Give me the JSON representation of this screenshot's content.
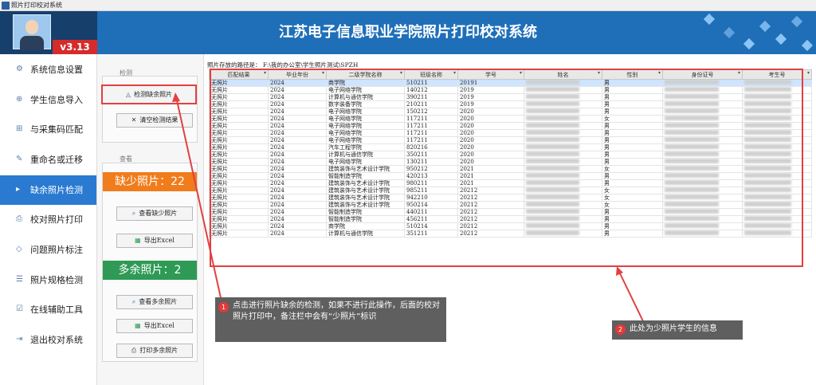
{
  "window": {
    "title": "照片打印校对系统"
  },
  "header": {
    "app_title": "江苏电子信息职业学院照片打印校对系统",
    "version": "v3.13"
  },
  "sidebar": {
    "items": [
      {
        "label": "系统信息设置",
        "icon": "gear-icon"
      },
      {
        "label": "学生信息导入",
        "icon": "import-icon"
      },
      {
        "label": "与采集码匹配",
        "icon": "match-icon"
      },
      {
        "label": "重命名或迁移",
        "icon": "rename-icon"
      },
      {
        "label": "缺余照片检测",
        "icon": "detect-icon",
        "active": true
      },
      {
        "label": "校对照片打印",
        "icon": "print-icon"
      },
      {
        "label": "问题照片标注",
        "icon": "tag-icon"
      },
      {
        "label": "照片规格检测",
        "icon": "spec-icon"
      },
      {
        "label": "在线辅助工具",
        "icon": "tool-icon"
      },
      {
        "label": "退出校对系统",
        "icon": "exit-icon"
      }
    ]
  },
  "panel": {
    "group_detect": "检测",
    "btn_detect_missing": "检测缺余照片",
    "btn_clear": "清空检测结果",
    "group_view": "查看",
    "missing_stat": "缺少照片：22",
    "btn_view_missing": "查看缺少照片",
    "btn_export_missing": "导出Excel",
    "extra_stat": "多余照片：2",
    "btn_view_extra": "查看多余照片",
    "btn_export_extra": "导出Excel",
    "btn_print_extra": "打印多余照片"
  },
  "content": {
    "path_label": "照片存放的路径是：  F:\\我的办公室\\学生照片测试\\SPZH",
    "columns": [
      "匹配结果",
      "毕业年份",
      "二级学院名称",
      "班级名称",
      "学号",
      "姓名",
      "性别",
      "身份证号",
      "考生号"
    ],
    "rows": [
      [
        "无照片",
        "2024",
        "商学院",
        "510211",
        "20191",
        "",
        "男",
        "",
        ""
      ],
      [
        "无照片",
        "2024",
        "电子网络学院",
        "140212",
        "2019",
        "",
        "男",
        "",
        ""
      ],
      [
        "无照片",
        "2024",
        "计算机与通信学院",
        "390211",
        "2019",
        "",
        "男",
        "",
        ""
      ],
      [
        "无照片",
        "2024",
        "数字装备学院",
        "210211",
        "2019",
        "",
        "男",
        "",
        ""
      ],
      [
        "无照片",
        "2024",
        "电子网络学院",
        "150212",
        "2020",
        "",
        "男",
        "",
        ""
      ],
      [
        "无照片",
        "2024",
        "电子网络学院",
        "117211",
        "2020",
        "",
        "女",
        "",
        ""
      ],
      [
        "无照片",
        "2024",
        "电子网络学院",
        "117211",
        "2020",
        "",
        "男",
        "",
        ""
      ],
      [
        "无照片",
        "2024",
        "电子网络学院",
        "117211",
        "2020",
        "",
        "男",
        "",
        ""
      ],
      [
        "无照片",
        "2024",
        "电子网络学院",
        "117211",
        "2020",
        "",
        "男",
        "",
        ""
      ],
      [
        "无照片",
        "2024",
        "汽车工程学院",
        "820216",
        "2020",
        "",
        "男",
        "",
        ""
      ],
      [
        "无照片",
        "2024",
        "计算机与通信学院",
        "350211",
        "2020",
        "",
        "男",
        "",
        ""
      ],
      [
        "无照片",
        "2024",
        "电子网络学院",
        "130211",
        "2020",
        "",
        "男",
        "",
        ""
      ],
      [
        "无照片",
        "2024",
        "建筑装饰与艺术设计学院",
        "950212",
        "2021",
        "",
        "女",
        "",
        ""
      ],
      [
        "无照片",
        "2024",
        "智能制造学院",
        "420213",
        "2021",
        "",
        "男",
        "",
        ""
      ],
      [
        "无照片",
        "2024",
        "建筑装饰与艺术设计学院",
        "980211",
        "2021",
        "",
        "男",
        "",
        ""
      ],
      [
        "无照片",
        "2024",
        "建筑装饰与艺术设计学院",
        "985211",
        "20212",
        "",
        "女",
        "",
        ""
      ],
      [
        "无照片",
        "2024",
        "建筑装饰与艺术设计学院",
        "942210",
        "20212",
        "",
        "女",
        "",
        ""
      ],
      [
        "无照片",
        "2024",
        "建筑装饰与艺术设计学院",
        "950214",
        "20212",
        "",
        "女",
        "",
        ""
      ],
      [
        "无照片",
        "2024",
        "智能制造学院",
        "440211",
        "20212",
        "",
        "男",
        "",
        ""
      ],
      [
        "无照片",
        "2024",
        "智能制造学院",
        "456211",
        "20212",
        "",
        "男",
        "",
        ""
      ],
      [
        "无照片",
        "2024",
        "商学院",
        "510214",
        "20212",
        "",
        "男",
        "",
        ""
      ],
      [
        "无照片",
        "2024",
        "计算机与通信学院",
        "351211",
        "20212",
        "",
        "男",
        "",
        ""
      ]
    ]
  },
  "callouts": {
    "c1_num": "1",
    "c1_text": "点击进行照片缺余的检测，如果不进行此操作，后面的校对照片打印中，备注栏中会有“少照片”标识",
    "c2_num": "2",
    "c2_text": "此处为少照片学生的信息"
  },
  "colors": {
    "header": "#1f6fb8",
    "active_nav": "#2a7ad1",
    "missing": "#f07c1c",
    "extra": "#2e9a55",
    "annotation": "#e24040"
  }
}
